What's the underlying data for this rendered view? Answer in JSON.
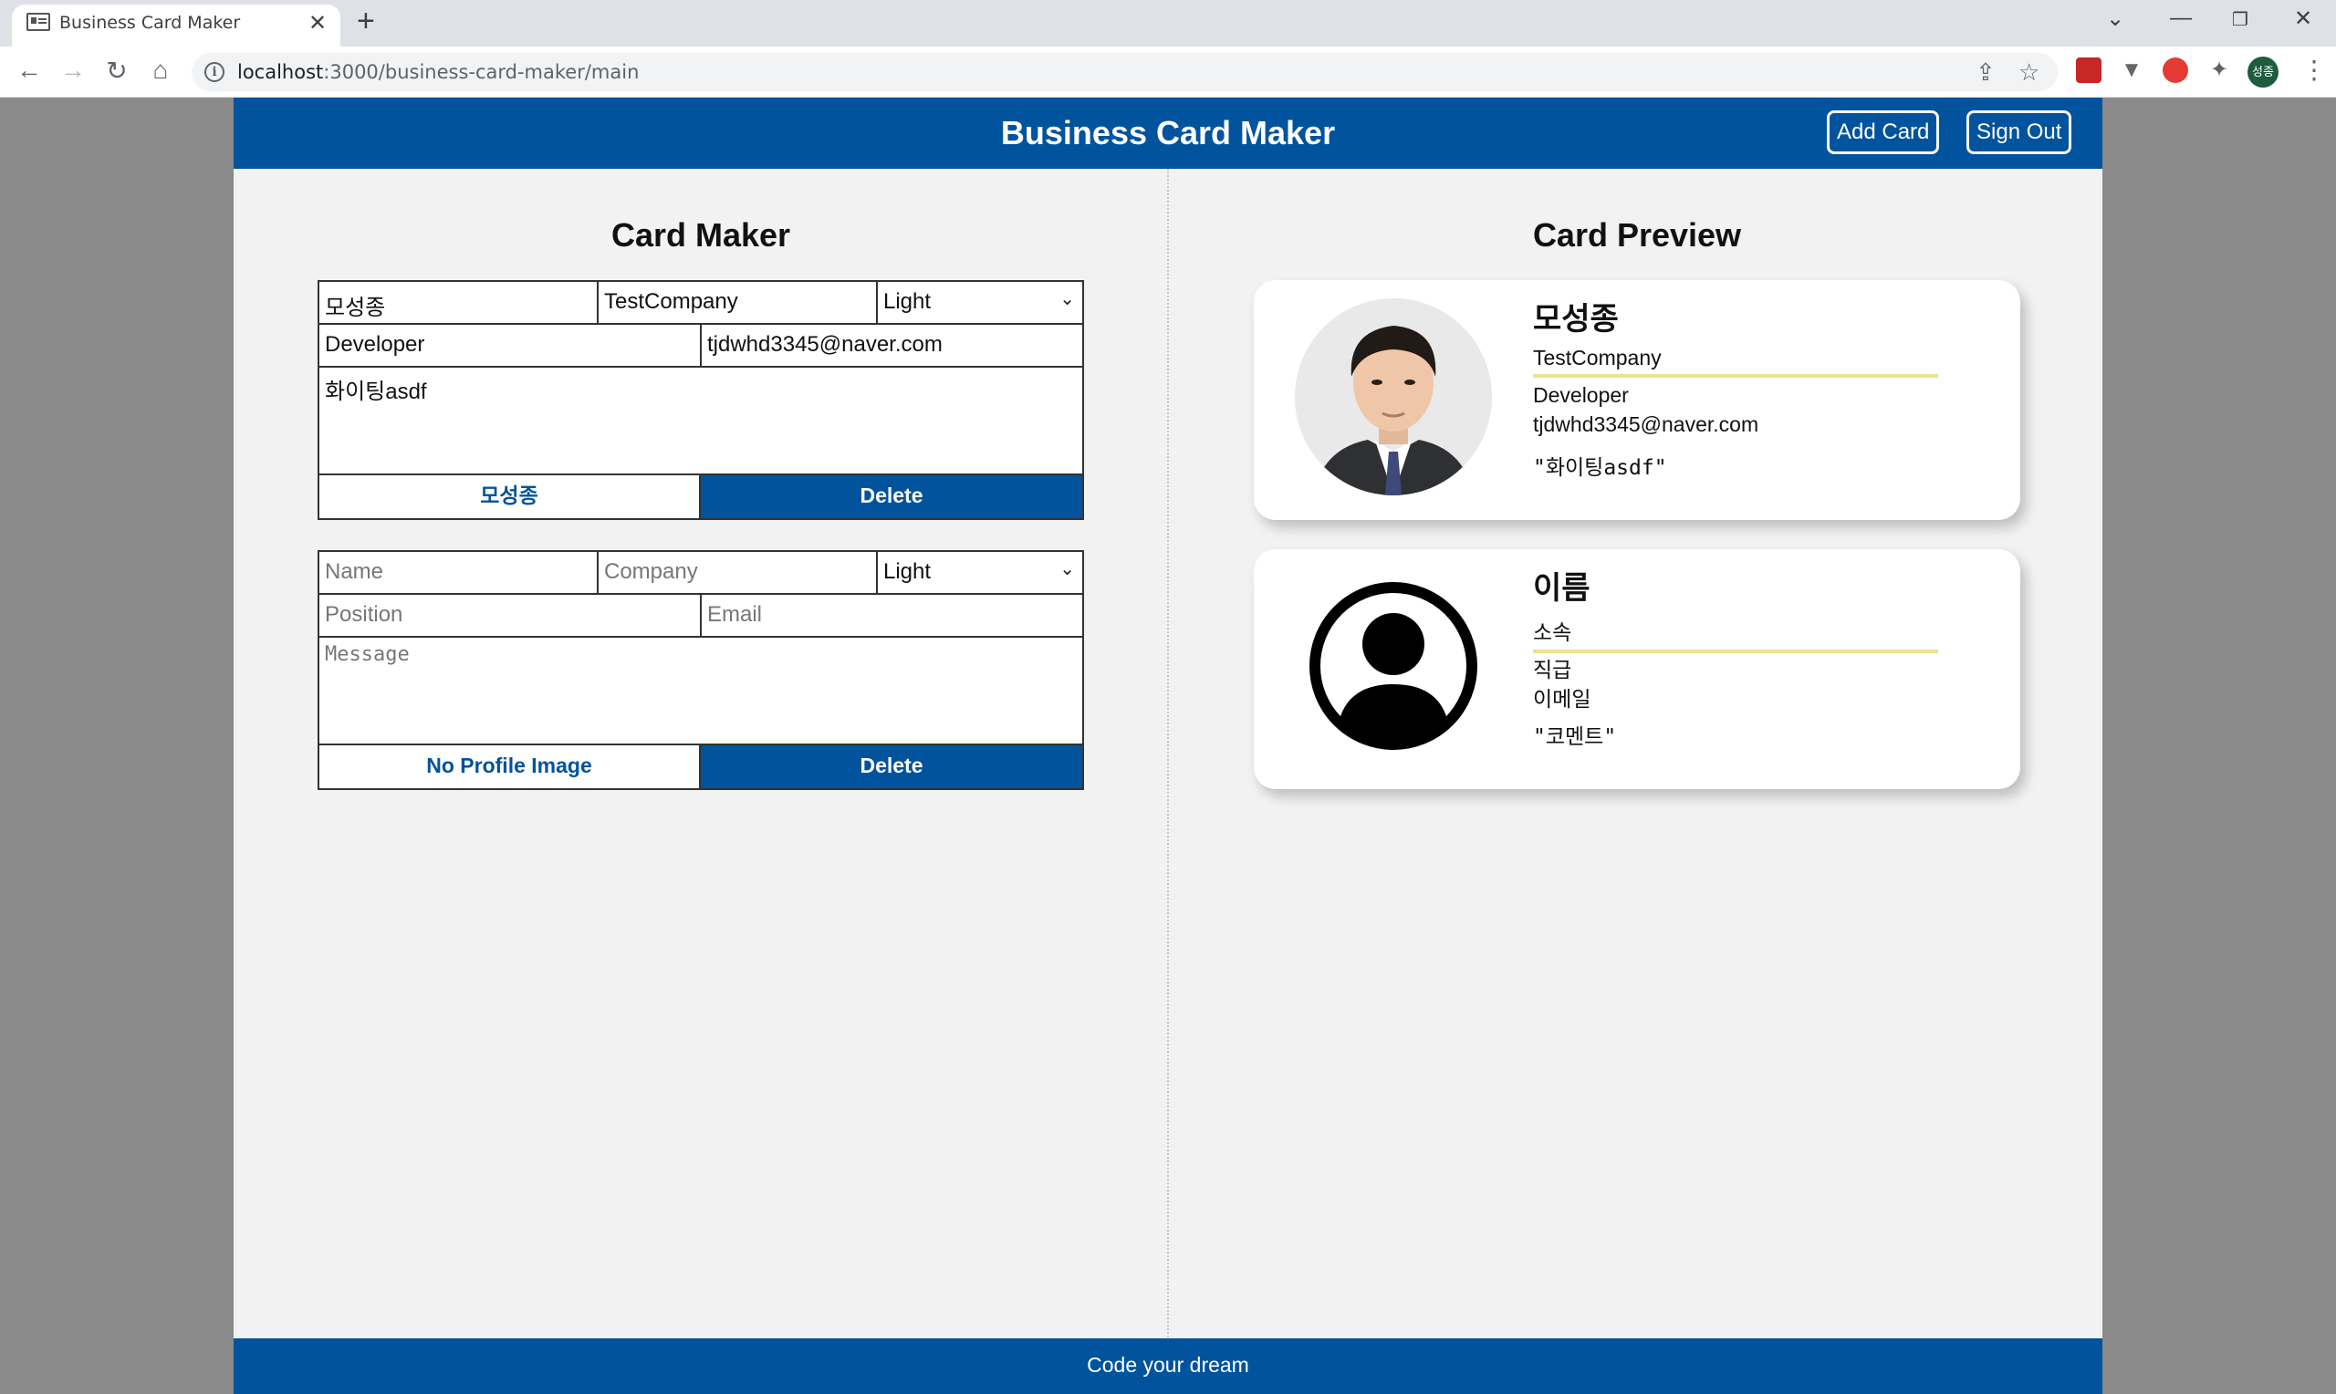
{
  "browser": {
    "tab_title": "Business Card Maker",
    "url_host": "localhost",
    "url_path": ":3000/business-card-maker/main",
    "profile_initials": "성종"
  },
  "header": {
    "title": "Business Card Maker",
    "add_card_label": "Add Card",
    "sign_out_label": "Sign Out"
  },
  "editor": {
    "title": "Card Maker",
    "cards": [
      {
        "name": "모성종",
        "company": "TestCompany",
        "theme": "Light",
        "position": "Developer",
        "email": "tjdwhd3345@naver.com",
        "message": "화이팅asdf",
        "file_label": "모성종",
        "delete_label": "Delete"
      },
      {
        "name_placeholder": "Name",
        "company_placeholder": "Company",
        "theme": "Light",
        "position_placeholder": "Position",
        "email_placeholder": "Email",
        "message_placeholder": "Message",
        "file_label": "No Profile Image",
        "delete_label": "Delete"
      }
    ]
  },
  "preview": {
    "title": "Card Preview",
    "cards": [
      {
        "name": "모성종",
        "company": "TestCompany",
        "position": "Developer",
        "email": "tjdwhd3345@naver.com",
        "message": "\"화이팅asdf\"",
        "avatar_icon": "profile-photo"
      },
      {
        "name": "이름",
        "company": "소속",
        "position": "직급",
        "email": "이메일",
        "message": "\"코멘트\"",
        "avatar_icon": "default-user-icon"
      }
    ]
  },
  "footer": {
    "text": "Code your dream"
  },
  "colors": {
    "brand": "#00539c",
    "accent_line": "#f0e08a"
  }
}
